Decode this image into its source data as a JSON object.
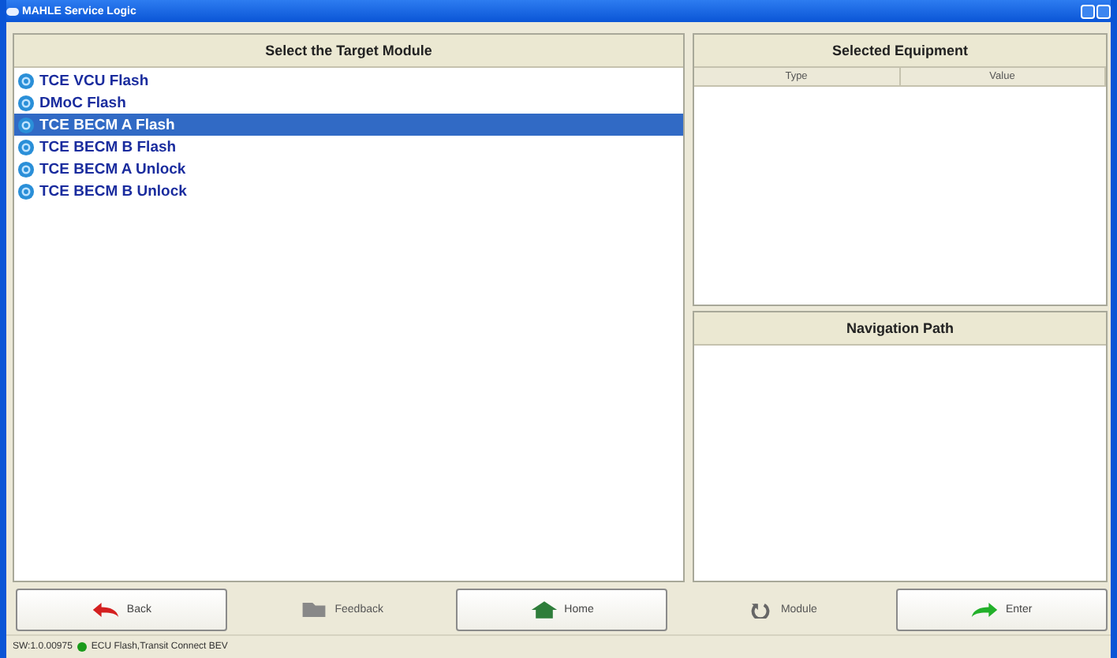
{
  "window": {
    "title": "MAHLE Service Logic"
  },
  "modules": {
    "title": "Select the Target Module",
    "items": [
      {
        "label": "TCE VCU Flash",
        "selected": false
      },
      {
        "label": "DMoC Flash",
        "selected": false
      },
      {
        "label": "TCE BECM A Flash",
        "selected": true
      },
      {
        "label": "TCE BECM B Flash",
        "selected": false
      },
      {
        "label": "TCE BECM A Unlock",
        "selected": false
      },
      {
        "label": "TCE BECM B Unlock",
        "selected": false
      }
    ]
  },
  "equipment": {
    "title": "Selected Equipment",
    "columns": [
      "Type",
      "Value"
    ]
  },
  "navigation": {
    "title": "Navigation Path"
  },
  "buttons": [
    {
      "label": "Back",
      "kind": "back",
      "enabled": true
    },
    {
      "label": "Feedback",
      "kind": "feedback",
      "enabled": false
    },
    {
      "label": "Home",
      "kind": "home",
      "enabled": true
    },
    {
      "label": "Module",
      "kind": "module",
      "enabled": false
    },
    {
      "label": "Enter",
      "kind": "enter",
      "enabled": true
    }
  ],
  "status_bar": {
    "version": "SW:1.0.00975",
    "connection": "ECU Flash,Transit Connect BEV",
    "color": "#1a9a1a"
  }
}
